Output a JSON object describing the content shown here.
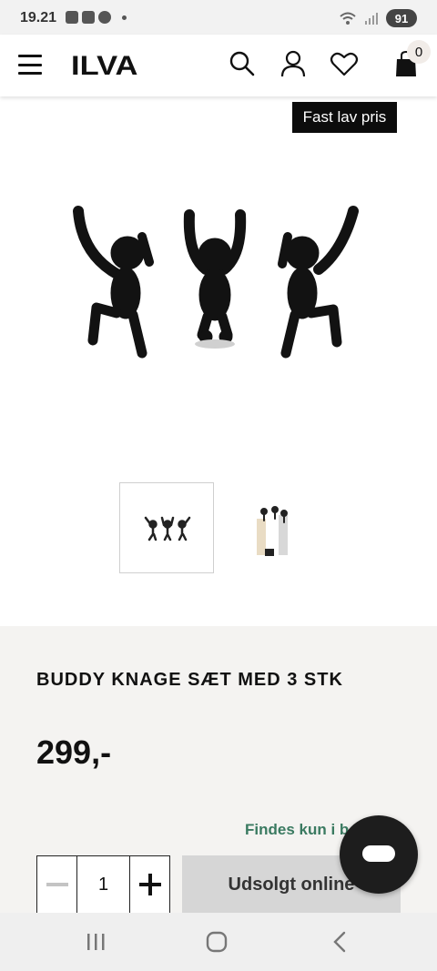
{
  "status_bar": {
    "time": "19.21",
    "battery": "91"
  },
  "header": {
    "logo": "ILVA",
    "cart_count": "0"
  },
  "product": {
    "badge": "Fast lav pris",
    "brand": "BUDDY",
    "name": "KNAGE SÆT MED 3 STK",
    "price": "299,-",
    "store_note": "Findes kun i b",
    "quantity": "1",
    "soldout_label": "Udsolgt online"
  },
  "colors": {
    "accent_green": "#3a7a61",
    "badge_bg": "#0c0c0c",
    "info_bg": "#f4f3f1"
  }
}
